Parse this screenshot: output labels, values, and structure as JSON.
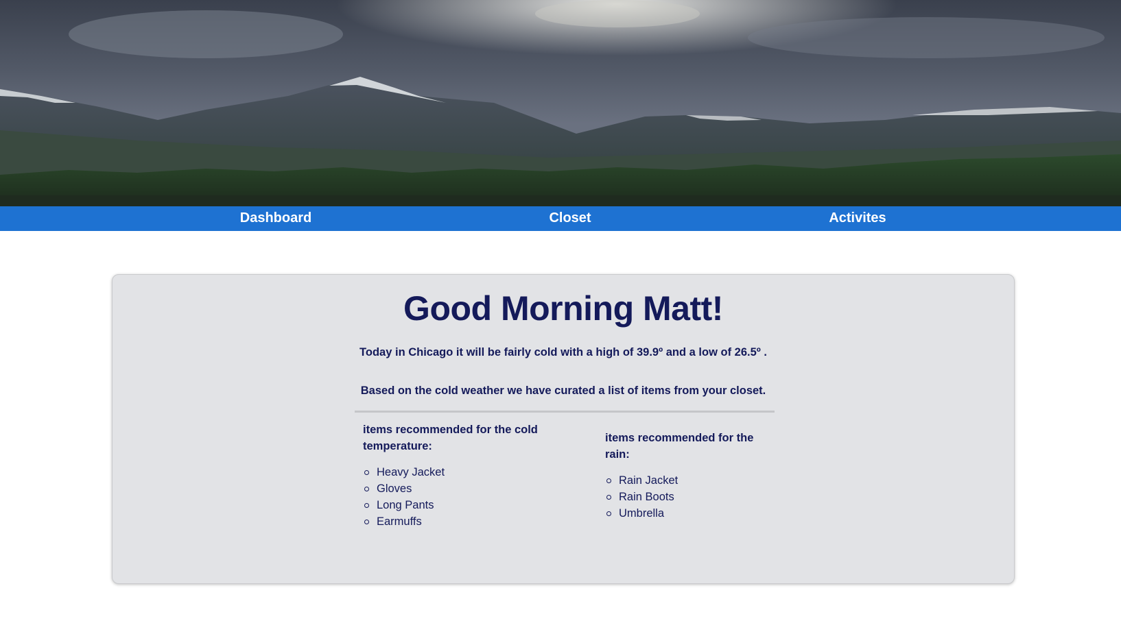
{
  "hero": {
    "image_icon": "mountain-landscape-image"
  },
  "nav": {
    "items": [
      {
        "label": "Dashboard"
      },
      {
        "label": "Closet"
      },
      {
        "label": "Activites"
      }
    ],
    "color": "#1e72d2"
  },
  "main": {
    "greeting": "Good Morning Matt!",
    "forecast": "Today in Chicago it will be fairly cold with a high of 39.9º and a low of 26.5º .",
    "curation_note": "Based on the cold weather we have curated a list of items from your closet.",
    "cold": {
      "title": "items recommended for the cold temperature:",
      "items": [
        "Heavy Jacket",
        "Gloves",
        "Long Pants",
        "Earmuffs"
      ]
    },
    "rain": {
      "title": "items recommended for the rain:",
      "items": [
        "Rain Jacket",
        "Rain Boots",
        "Umbrella"
      ]
    }
  },
  "colors": {
    "text": "#141a5a",
    "card": "#e2e3e6"
  }
}
